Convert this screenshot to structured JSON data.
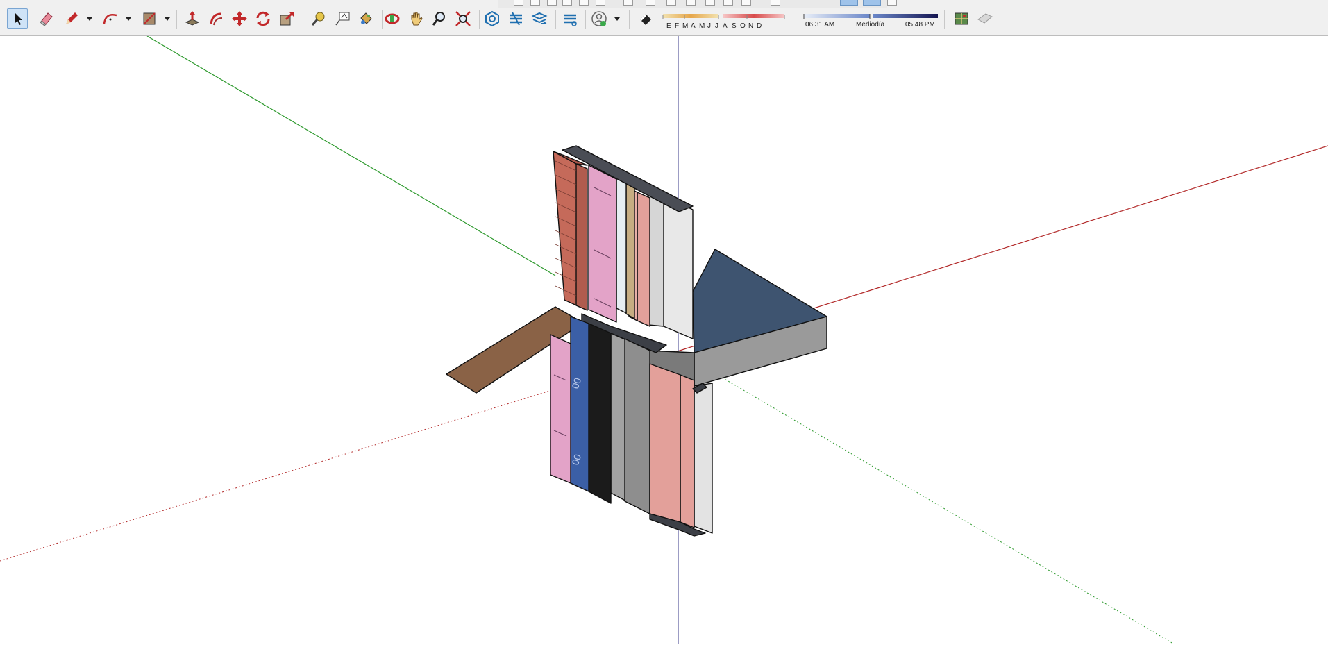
{
  "toolbar": {
    "tools": [
      {
        "id": "select",
        "icon": "select-arrow-icon",
        "active": true
      },
      {
        "id": "eraser",
        "icon": "eraser-icon"
      },
      {
        "id": "line",
        "icon": "pencil-icon"
      },
      {
        "id": "arc",
        "icon": "arc-icon"
      },
      {
        "id": "shapes",
        "icon": "rectangle-icon"
      },
      {
        "id": "push-pull",
        "icon": "push-pull-icon"
      },
      {
        "id": "follow-me",
        "icon": "follow-me-icon"
      },
      {
        "id": "move",
        "icon": "move-icon"
      },
      {
        "id": "rotate",
        "icon": "rotate-icon"
      },
      {
        "id": "scale",
        "icon": "scale-icon"
      },
      {
        "id": "tape-measure",
        "icon": "tape-measure-icon"
      },
      {
        "id": "text",
        "icon": "text-icon"
      },
      {
        "id": "paint-bucket",
        "icon": "paint-bucket-icon"
      },
      {
        "id": "orbit",
        "icon": "orbit-icon"
      },
      {
        "id": "pan",
        "icon": "pan-hand-icon"
      },
      {
        "id": "zoom",
        "icon": "zoom-icon"
      },
      {
        "id": "zoom-extents",
        "icon": "zoom-extents-icon"
      },
      {
        "id": "3d-warehouse",
        "icon": "warehouse-icon"
      },
      {
        "id": "extension-warehouse",
        "icon": "extension-warehouse-icon"
      },
      {
        "id": "share-model",
        "icon": "share-model-icon"
      },
      {
        "id": "layout",
        "icon": "layout-icon"
      },
      {
        "id": "account",
        "icon": "account-icon"
      },
      {
        "id": "shadows-toggle",
        "icon": "shadows-icon"
      },
      {
        "id": "geolocate",
        "icon": "geolocation-icon"
      },
      {
        "id": "photo-textures",
        "icon": "photo-textures-icon"
      }
    ]
  },
  "shadows": {
    "months": [
      "E",
      "F",
      "M",
      "A",
      "M",
      "J",
      "J",
      "A",
      "S",
      "O",
      "N",
      "D"
    ],
    "sunrise": "06:31 AM",
    "midday": "Mediodía",
    "sunset": "05:48 PM"
  },
  "model": {
    "insulation_print": "00"
  },
  "colors": {
    "green_axis": "#2e9a2e",
    "red_axis": "#b32b2b",
    "blue_axis": "#3a3a8a",
    "brick": "#c56a5a",
    "pink_board": "#e3a3c8",
    "blue_board": "#3b5fa6",
    "concrete": "#9a9a9a",
    "slab_top": "#3e5470",
    "ground": "#8a6246",
    "gypsum": "#e8e8e8"
  }
}
